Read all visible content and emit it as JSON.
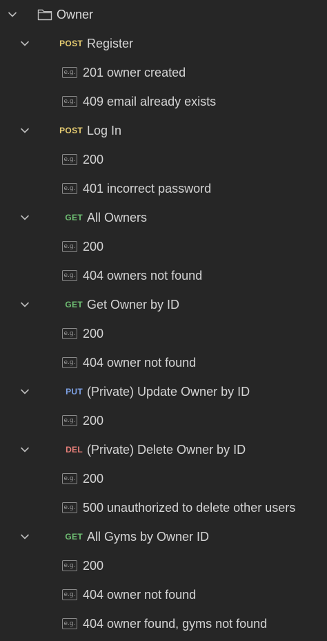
{
  "colors": {
    "background": "#262626",
    "post": "#e6cc71",
    "get": "#6fbf73",
    "put": "#7ea2e6",
    "del": "#e8807a"
  },
  "folder": {
    "label": "Owner",
    "icon": "folder-icon",
    "expand_icon": "chevron-down-icon"
  },
  "example_icon_text": "e.g.",
  "requests": [
    {
      "method": "POST",
      "method_color": "#e6cc71",
      "name": "Register",
      "examples": [
        "201 owner created",
        "409 email already exists"
      ]
    },
    {
      "method": "POST",
      "method_color": "#e6cc71",
      "name": "Log In",
      "examples": [
        "200",
        "401 incorrect password"
      ]
    },
    {
      "method": "GET",
      "method_color": "#6fbf73",
      "name": "All Owners",
      "examples": [
        "200",
        "404 owners not found"
      ]
    },
    {
      "method": "GET",
      "method_color": "#6fbf73",
      "name": "Get Owner by ID",
      "examples": [
        "200",
        "404 owner not found"
      ]
    },
    {
      "method": "PUT",
      "method_color": "#7ea2e6",
      "name": "(Private) Update Owner by ID",
      "examples": [
        "200"
      ]
    },
    {
      "method": "DEL",
      "method_color": "#e8807a",
      "name": "(Private) Delete Owner by ID",
      "examples": [
        "200",
        "500 unauthorized to delete other users"
      ]
    },
    {
      "method": "GET",
      "method_color": "#6fbf73",
      "name": "All Gyms by Owner ID",
      "examples": [
        "200",
        "404 owner not found",
        "404 owner found, gyms not found"
      ]
    }
  ]
}
